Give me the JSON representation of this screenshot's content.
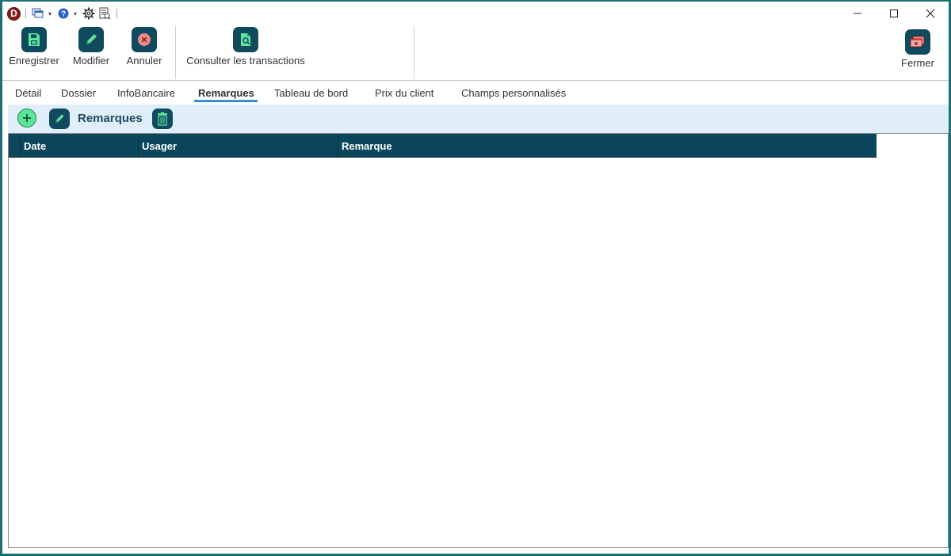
{
  "titlebar": {
    "app_logo_letter": "D",
    "quick_access": [
      "windows-icon",
      "help-icon",
      "gear-icon",
      "report-icon"
    ]
  },
  "ribbon": {
    "buttons": [
      {
        "label": "Enregistrer",
        "icon": "save-icon"
      },
      {
        "label": "Modifier",
        "icon": "pencil-icon"
      },
      {
        "label": "Annuler",
        "icon": "cancel-icon"
      },
      {
        "label": "Consulter les transactions",
        "icon": "document-search-icon"
      },
      {
        "label": "Fermer",
        "icon": "close-window-icon"
      }
    ]
  },
  "tabs": [
    {
      "label": "Détail"
    },
    {
      "label": "Dossier"
    },
    {
      "label": "InfoBancaire"
    },
    {
      "label": "Remarques",
      "active": true
    },
    {
      "label": "Tableau de bord"
    },
    {
      "label": "Prix du client"
    },
    {
      "label": "Champs personnalisés"
    }
  ],
  "panel": {
    "title": "Remarques",
    "actions": [
      "add-icon",
      "pencil-icon",
      "trash-icon"
    ]
  },
  "grid": {
    "columns": [
      "Date",
      "Usager",
      "Remarque"
    ],
    "rows": []
  },
  "colors": {
    "accent": "#0f4a5e",
    "tab_underline": "#3b8ecf",
    "panel_bg": "#dfeef9",
    "add_green": "#5ee39a",
    "cancel_red": "#f08a8a"
  }
}
